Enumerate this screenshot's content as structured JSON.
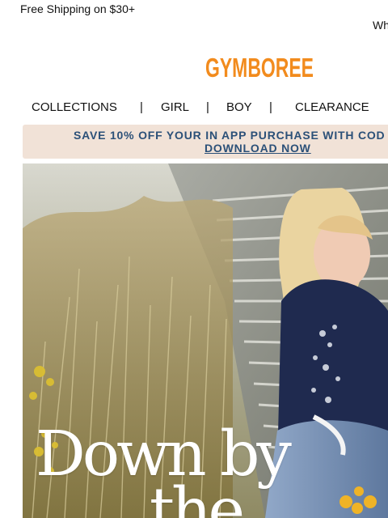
{
  "header": {
    "free_shipping": "Free Shipping on $30+",
    "top_right_link": "Wh",
    "brand_logo": "GYMBOREE"
  },
  "nav": {
    "items": [
      "COLLECTIONS",
      "GIRL",
      "BOY",
      "CLEARANCE"
    ],
    "separators": [
      "|",
      "|",
      "|"
    ]
  },
  "promo": {
    "text": "SAVE 10% OFF YOUR IN APP PURCHASE WITH COD",
    "link_text": "DOWNLOAD NOW",
    "background": "#f1e2d7",
    "text_color": "#2b5078"
  },
  "hero": {
    "headline_line1": "Down by",
    "headline_line2": "the"
  },
  "colors": {
    "logo_orange": "#f28b1d",
    "nav_text": "#111111"
  },
  "icons": []
}
